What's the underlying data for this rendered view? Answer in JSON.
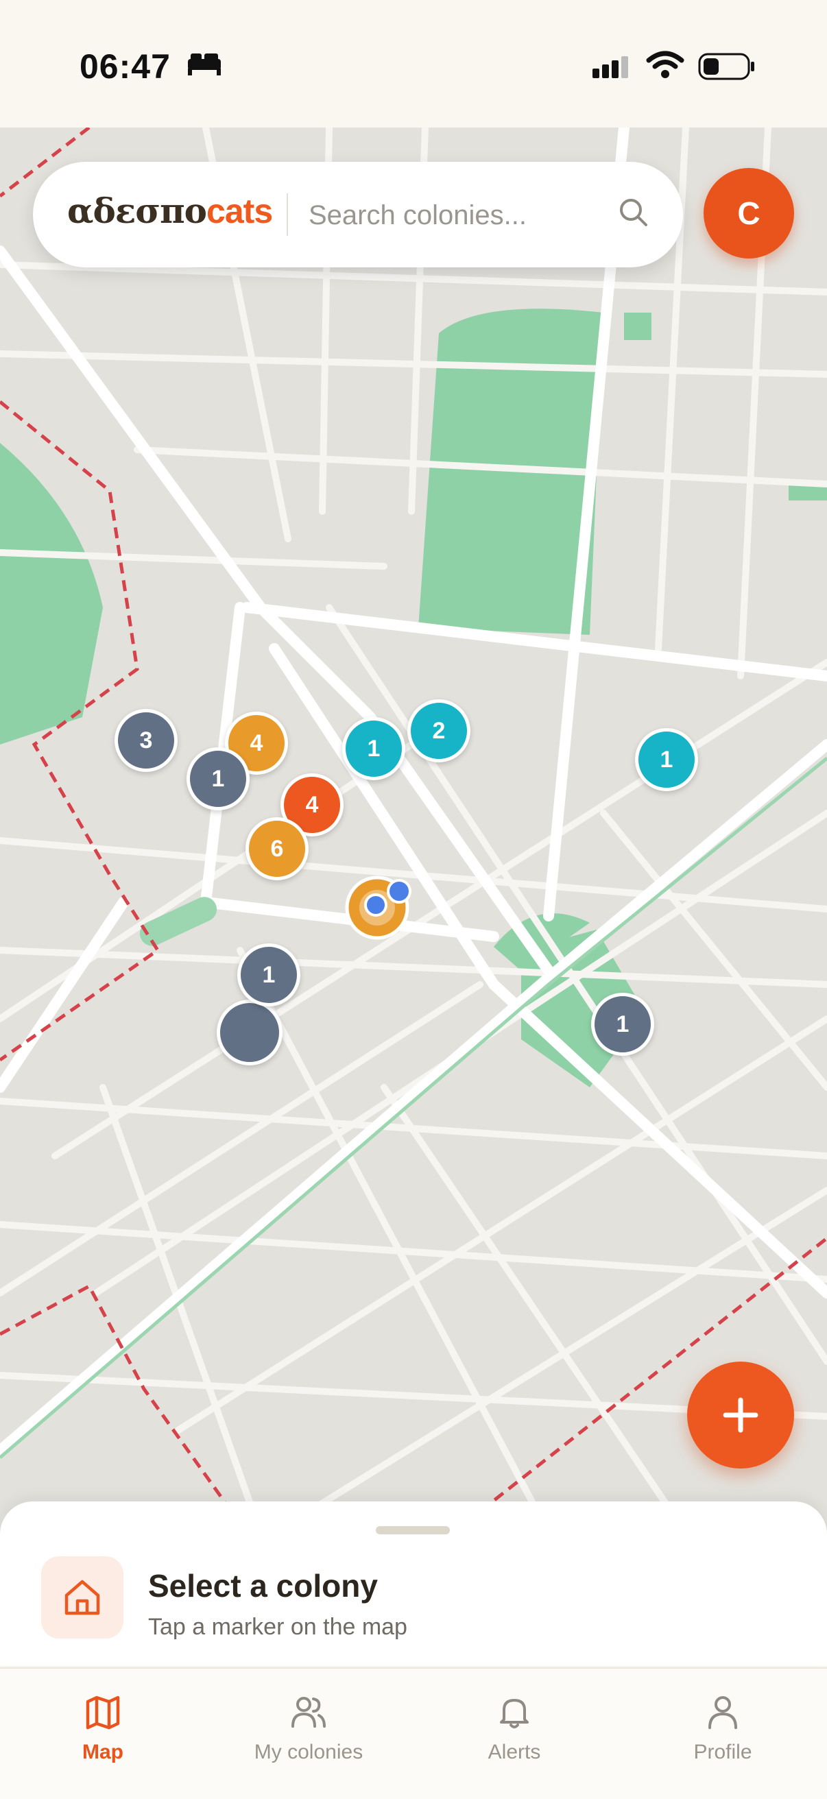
{
  "status_bar": {
    "time": "06:47"
  },
  "app": {
    "logo_greek": "αδεσπο",
    "logo_latin": "cats",
    "avatar_initial": "C"
  },
  "search": {
    "placeholder": "Search colonies..."
  },
  "map": {
    "markers": [
      {
        "count": "3",
        "color": "#617085"
      },
      {
        "count": "4",
        "color": "#e89a2a"
      },
      {
        "count": "1",
        "color": "#617085"
      },
      {
        "count": "4",
        "color": "#ec5820"
      },
      {
        "count": "6",
        "color": "#e89a2a"
      },
      {
        "count": "1",
        "color": "#17b3c6"
      },
      {
        "count": "2",
        "color": "#17b3c6"
      },
      {
        "count": "1",
        "color": "#17b3c6"
      },
      {
        "count": "1",
        "color": "#617085"
      },
      {
        "count": "1",
        "color": "#617085"
      }
    ]
  },
  "sheet": {
    "title": "Select a colony",
    "subtitle": "Tap a marker on the map"
  },
  "tabs": [
    {
      "label": "Map",
      "icon": "map-icon",
      "active": true
    },
    {
      "label": "My colonies",
      "icon": "users-icon",
      "active": false
    },
    {
      "label": "Alerts",
      "icon": "bell-icon",
      "active": false
    },
    {
      "label": "Profile",
      "icon": "user-icon",
      "active": false
    }
  ],
  "colors": {
    "accent": "#ec5820",
    "teal": "#17b3c6",
    "slate": "#617085",
    "amber": "#e89a2a",
    "park": "#8dd0a3"
  }
}
